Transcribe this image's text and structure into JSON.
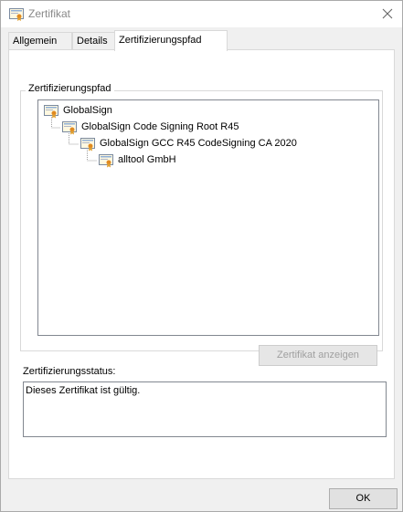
{
  "window": {
    "title": "Zertifikat",
    "close_icon": "close-icon"
  },
  "tabs": [
    {
      "label": "Allgemein",
      "active": false
    },
    {
      "label": "Details",
      "active": false
    },
    {
      "label": "Zertifizierungspfad",
      "active": true
    }
  ],
  "path_group": {
    "label": "Zertifizierungspfad",
    "items": [
      {
        "label": "GlobalSign",
        "level": 0,
        "icon": "certificate-icon"
      },
      {
        "label": "GlobalSign Code Signing Root R45",
        "level": 1,
        "icon": "certificate-icon"
      },
      {
        "label": "GlobalSign GCC R45 CodeSigning CA 2020",
        "level": 2,
        "icon": "certificate-icon"
      },
      {
        "label": "alltool GmbH",
        "level": 3,
        "icon": "certificate-icon",
        "selected": true
      }
    ],
    "view_button_label": "Zertifikat anzeigen"
  },
  "status": {
    "label": "Zertifizierungsstatus:",
    "text": "Dieses Zertifikat ist gültig."
  },
  "footer": {
    "ok_label": "OK"
  }
}
